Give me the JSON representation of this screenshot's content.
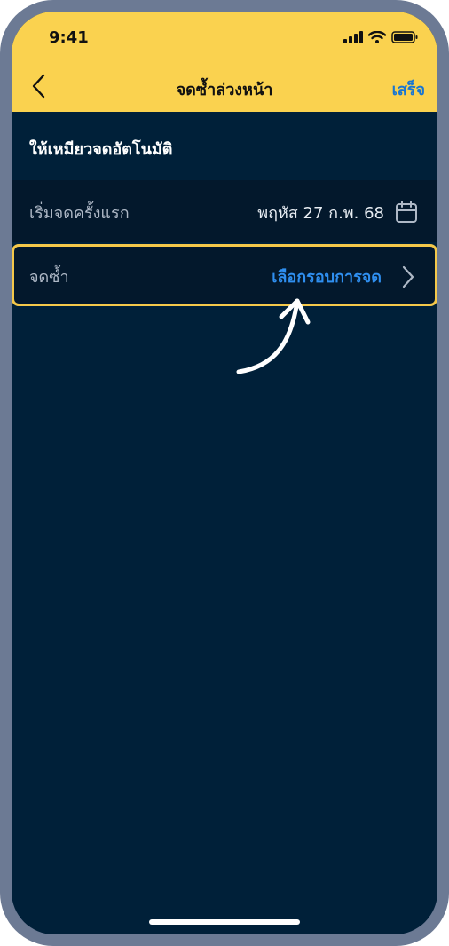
{
  "status_bar": {
    "time": "9:41",
    "icons": [
      "signal-icon",
      "wifi-icon",
      "battery-icon"
    ]
  },
  "nav": {
    "back_icon": "chevron-left-icon",
    "title": "จดซ้ำล่วงหน้า",
    "done_label": "เสร็จ"
  },
  "section": {
    "title": "ให้เหมียวจดอัตโนมัติ"
  },
  "rows": {
    "start": {
      "label": "เริ่มจดครั้งแรก",
      "value": "พฤหัส 27 ก.พ. 68",
      "icon": "calendar-icon"
    },
    "repeat": {
      "label": "จดซ้ำ",
      "value": "เลือกรอบการจด",
      "icon": "chevron-right-icon"
    }
  },
  "colors": {
    "header_yellow": "#fad24f",
    "background_navy": "#002039",
    "row_bg": "#03182c",
    "link_blue": "#2f8ff0",
    "highlight_border": "#f4c84a"
  }
}
